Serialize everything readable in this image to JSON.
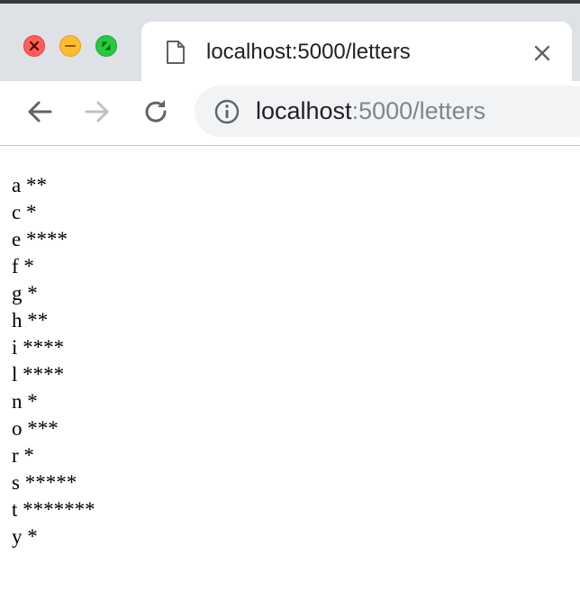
{
  "window": {
    "controls": [
      "close",
      "minimize",
      "fullscreen"
    ]
  },
  "tab": {
    "title": "localhost:5000/letters",
    "icon": "document-icon",
    "close_icon": "close-icon"
  },
  "toolbar": {
    "back_icon": "arrow-left-icon",
    "forward_icon": "arrow-right-icon",
    "reload_icon": "reload-icon",
    "info_icon": "info-icon",
    "url_host": "localhost",
    "url_rest": ":5000/letters"
  },
  "page": {
    "rows": [
      {
        "letter": "a",
        "stars": "**"
      },
      {
        "letter": "c",
        "stars": "*"
      },
      {
        "letter": "e",
        "stars": "****"
      },
      {
        "letter": "f",
        "stars": "*"
      },
      {
        "letter": "g",
        "stars": "*"
      },
      {
        "letter": "h",
        "stars": "**"
      },
      {
        "letter": "i",
        "stars": "****"
      },
      {
        "letter": "l",
        "stars": "****"
      },
      {
        "letter": "n",
        "stars": "*"
      },
      {
        "letter": "o",
        "stars": "***"
      },
      {
        "letter": "r",
        "stars": "*"
      },
      {
        "letter": "s",
        "stars": "*****"
      },
      {
        "letter": "t",
        "stars": "*******"
      },
      {
        "letter": "y",
        "stars": "*"
      }
    ]
  },
  "colors": {
    "tabstrip": "#dee1e6",
    "omnibox": "#f1f3f4",
    "close": "#ff5f57",
    "minimize": "#febc2e",
    "fullscreen": "#28c840"
  }
}
